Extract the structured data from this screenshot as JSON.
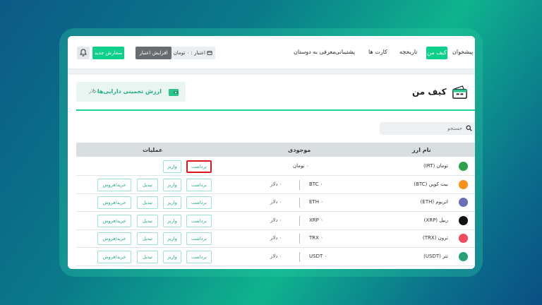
{
  "nav": {
    "items": [
      "پیشخوان",
      "تاریخچه",
      "کارت ها",
      "پشتیبانی",
      "معرفی به دوستان"
    ],
    "active": "کیف من",
    "credit_text": "اعتبار : ۰ تومان",
    "increase_credit": "افزایش اعتبار",
    "new_order": "سفارش جدید"
  },
  "wallet": {
    "title": "کیف من",
    "estimated_label": "ارزش تخمینی دارایی‌ها :",
    "estimated_value": "۰ دلار"
  },
  "search": {
    "placeholder": "جستجو"
  },
  "table": {
    "headers": [
      "نام ارز",
      "موجودی",
      "عملیات"
    ],
    "rows": [
      {
        "name": "تومان (IRT)",
        "amount": "۰ تومان",
        "symbol": "",
        "icon": "iran-flag-icon",
        "color": "#2aa14a",
        "buttons": [
          "برداشت",
          "واریز"
        ]
      },
      {
        "name": "بیت کوین (BTC)",
        "amount": "۰ دلار",
        "symbol": "BTC  ۰",
        "icon": "bitcoin-icon",
        "color": "#f7931a",
        "buttons": [
          "برداشت",
          "واریز",
          "تبدیل",
          "خرید/فروش"
        ]
      },
      {
        "name": "اتریوم (ETH)",
        "amount": "۰ دلار",
        "symbol": "ETH  ۰",
        "icon": "ethereum-icon",
        "color": "#6b6fb8",
        "buttons": [
          "برداشت",
          "واریز",
          "تبدیل",
          "خرید/فروش"
        ]
      },
      {
        "name": "ریپل (XRP)",
        "amount": "۰ دلار",
        "symbol": "XRP  ۰",
        "icon": "ripple-icon",
        "color": "#111111",
        "buttons": [
          "برداشت",
          "واریز",
          "تبدیل",
          "خرید/فروش"
        ]
      },
      {
        "name": "ترون (TRX)",
        "amount": "۰ دلار",
        "symbol": "TRX  ۰",
        "icon": "tron-icon",
        "color": "#ef4b5f",
        "buttons": [
          "برداشت",
          "واریز",
          "تبدیل",
          "خرید/فروش"
        ]
      },
      {
        "name": "تتر (USDT)",
        "amount": "۰ دلار",
        "symbol": "USDT  ۰",
        "icon": "tether-icon",
        "color": "#26a17b",
        "buttons": [
          "برداشت",
          "واریز",
          "تبدیل",
          "خرید/فروش"
        ]
      }
    ]
  },
  "colors": {
    "accent": "#0fd08a",
    "highlight": "#e0141d"
  }
}
